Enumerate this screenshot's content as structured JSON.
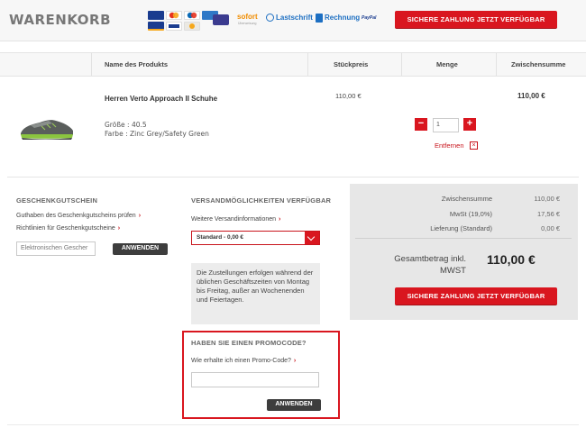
{
  "header": {
    "title": "WARENKORB",
    "payment_methods": [
      {
        "name": "VISA",
        "color": "#1a3c8f"
      },
      {
        "name": "Mastercard",
        "color": "#e6331f"
      },
      {
        "name": "Maestro",
        "color": "#0a6ab5"
      },
      {
        "name": "American Express",
        "color": "#2e78c7"
      },
      {
        "name": "Visa Electron",
        "color": "#1a3c8f"
      },
      {
        "name": "Diners Club",
        "color": "#ebe9e3"
      },
      {
        "name": "PayPal",
        "color": "#e4e4e4"
      }
    ],
    "payment_labels": {
      "sofort": "sofort",
      "lastschrift": "Lastschrift",
      "rechnung": "Rechnung",
      "paypal": "PayPal"
    },
    "cta_label": "SICHERE ZAHLUNG JETZT VERFÜGBAR"
  },
  "table": {
    "columns": [
      "Name des Produkts",
      "Stückpreis",
      "Menge",
      "Zwischensumme"
    ]
  },
  "item": {
    "name": "Herren Verto Approach II Schuhe",
    "size": "Größe : 40.5",
    "color": "Farbe : Zinc Grey/Safety Green",
    "unit_price": "110,00 €",
    "quantity": "1",
    "subtotal": "110,00 €",
    "remove_label": "Entfernen"
  },
  "gift_card": {
    "title": "GESCHENKGUTSCHEIN",
    "link_check": "Guthaben des Geschenkgutscheins prüfen",
    "link_terms": "Richtlinien für Geschenkgutscheine",
    "input_placeholder": "Elektronischen Gescher",
    "apply_label": "ANWENDEN"
  },
  "shipping": {
    "title": "VERSANDMÖGLICHKEITEN VERFÜGBAR",
    "more_info": "Weitere Versandinformationen",
    "selected": "Standard - 0,00 €",
    "notice": "Die Zustellungen erfolgen während der üblichen Geschäftszeiten von Montag bis Freitag, außer an Wochenenden und Feiertagen."
  },
  "promo": {
    "title": "HABEN SIE EINEN PROMOCODE?",
    "link": "Wie erhalte ich einen Promo-Code?",
    "input_value": "",
    "apply_label": "ANWENDEN"
  },
  "summary": {
    "rows": [
      {
        "label": "Zwischensumme",
        "value": "110,00 €"
      },
      {
        "label": "MwSt (19,0%)",
        "value": "17,56 €"
      },
      {
        "label": "Lieferung (Standard)",
        "value": "0,00 €"
      }
    ],
    "total_label": "Gesamtbetrag inkl. MWST",
    "total_value": "110,00 €",
    "cta_label": "SICHERE ZAHLUNG JETZT VERFÜGBAR"
  },
  "colors": {
    "accent": "#d9161f",
    "dark_button": "#3d3d3d",
    "summary_bg": "#e7e7e7",
    "shoe_body": "#5a5e5c",
    "shoe_accent": "#8bc53f"
  }
}
